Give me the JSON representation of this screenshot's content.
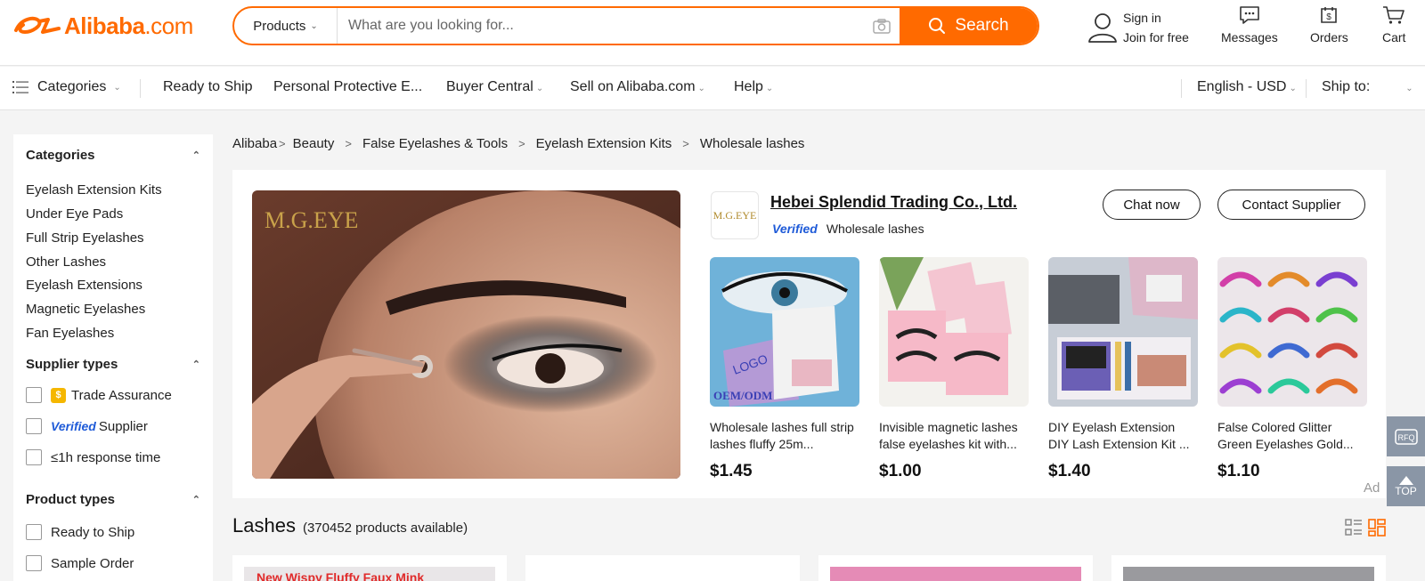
{
  "header": {
    "logo_text": "Alibaba",
    "logo_suffix": ".com",
    "search": {
      "category": "Products",
      "placeholder": "What are you looking for...",
      "button_label": "Search"
    },
    "signin": {
      "line1": "Sign in",
      "line2": "Join for free"
    },
    "messages_label": "Messages",
    "orders_label": "Orders",
    "cart_label": "Cart"
  },
  "nav": {
    "categories": "Categories",
    "ready_to_ship": "Ready to Ship",
    "ppe": "Personal Protective E...",
    "buyer_central": "Buyer Central",
    "sell": "Sell on Alibaba.com",
    "help": "Help",
    "language": "English - USD",
    "ship_to": "Ship to:"
  },
  "sidebar": {
    "categories_title": "Categories",
    "categories": [
      "Eyelash Extension Kits",
      "Under Eye Pads",
      "Full Strip Eyelashes",
      "Other Lashes",
      "Eyelash Extensions",
      "Magnetic Eyelashes",
      "Fan Eyelashes"
    ],
    "supplier_types_title": "Supplier types",
    "supplier_types": {
      "trade_assurance": "Trade Assurance",
      "verified": "Verified",
      "supplier": "Supplier",
      "response_time": "≤1h response time"
    },
    "product_types_title": "Product types",
    "product_types": [
      "Ready to Ship",
      "Sample Order"
    ]
  },
  "breadcrumb": [
    "Alibaba",
    "Beauty",
    "False Eyelashes & Tools",
    "Eyelash Extension Kits",
    "Wholesale lashes"
  ],
  "ad": {
    "hero_brand": "M.G.EYE",
    "supplier_logo_text": "M.G.EYE",
    "supplier_name": "Hebei Splendid Trading Co., Ltd.",
    "verified_label": "Verified",
    "supplier_category": "Wholesale lashes",
    "chat_label": "Chat now",
    "contact_label": "Contact Supplier",
    "products": [
      {
        "title": "Wholesale lashes full strip lashes fluffy 25m...",
        "price": "$1.45",
        "image_text": "LOGO",
        "image_subtext": "OEM/ODM"
      },
      {
        "title": "Invisible magnetic lashes false eyelashes kit with...",
        "price": "$1.00"
      },
      {
        "title": "DIY Eyelash Extension DIY Lash Extension Kit ...",
        "price": "$1.40"
      },
      {
        "title": "False Colored Glitter Green Eyelashes Gold...",
        "price": "$1.10"
      }
    ],
    "ad_tag": "Ad"
  },
  "results": {
    "title": "Lashes",
    "count": "(370452 products available)",
    "first_card_text": "New Wispy Fluffy Faux Mink"
  },
  "float": {
    "rfq": "RFQ",
    "top": "TOP"
  },
  "colors": {
    "accent": "#ff6a00",
    "verified": "#1f5bd8",
    "float": "#8a96a6"
  }
}
